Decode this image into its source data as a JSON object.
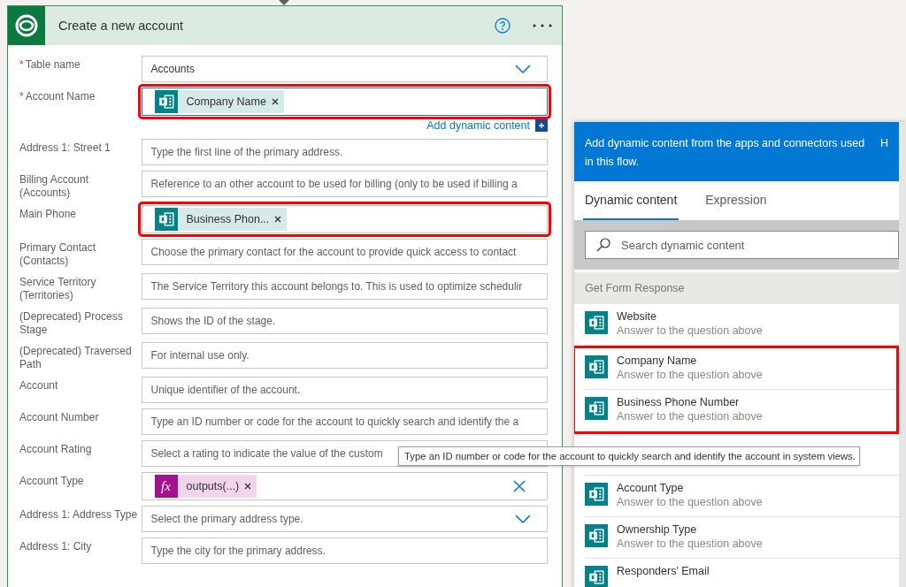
{
  "card": {
    "title": "Create a new account",
    "fields": [
      {
        "label": "Table name",
        "required_mark": "*",
        "kind": "select",
        "value": "Accounts",
        "highlighted": false
      },
      {
        "label": "Account Name",
        "required_mark": "*",
        "kind": "token",
        "token": {
          "text": "Company Name",
          "kind": "forms"
        },
        "highlighted": true,
        "focused": true,
        "link": "Add dynamic content"
      },
      {
        "label": "Address 1: Street 1",
        "kind": "text",
        "placeholder": "Type the first line of the primary address.",
        "highlighted": false
      },
      {
        "label": "Billing Account (Accounts)",
        "kind": "text",
        "placeholder": "Reference to an other account to be used for billing (only to be used if billing a",
        "highlighted": false
      },
      {
        "label": "Main Phone",
        "kind": "token",
        "token": {
          "text": "Business Phon...",
          "kind": "forms"
        },
        "highlighted": true,
        "focused": false
      },
      {
        "label": "Primary Contact (Contacts)",
        "kind": "text",
        "placeholder": "Choose the primary contact for the account to provide quick access to contact",
        "highlighted": false
      },
      {
        "label": "Service Territory (Territories)",
        "kind": "text",
        "placeholder": "The Service Territory this account belongs to. This is used to optimize schedulir",
        "highlighted": false
      },
      {
        "label": "(Deprecated) Process Stage",
        "kind": "text",
        "placeholder": "Shows the ID of the stage.",
        "highlighted": false
      },
      {
        "label": "(Deprecated) Traversed Path",
        "kind": "text",
        "placeholder": "For internal use only.",
        "highlighted": false
      },
      {
        "label": "Account",
        "kind": "text",
        "placeholder": "Unique identifier of the account.",
        "highlighted": false
      },
      {
        "label": "Account Number",
        "kind": "text",
        "placeholder": "Type an ID number or code for the account to quickly search and identify the a",
        "highlighted": false
      },
      {
        "label": "Account Rating",
        "kind": "text",
        "placeholder": "Select a rating to indicate the value of the custom",
        "highlighted": false
      },
      {
        "label": "Account Type",
        "kind": "token",
        "token": {
          "text": "outputs(...)",
          "kind": "expression",
          "icon_label": "fx"
        },
        "clearable": true,
        "highlighted": false,
        "focused": false
      },
      {
        "label": "Address 1: Address Type",
        "kind": "select",
        "placeholder": "Select the primary address type.",
        "highlighted": false
      },
      {
        "label": "Address 1: City",
        "kind": "text",
        "placeholder": "Type the city for the primary address.",
        "highlighted": false
      }
    ]
  },
  "panel": {
    "header": "Add dynamic content from the apps and connectors used in this flow.",
    "header_link": "H",
    "tabs": [
      {
        "label": "Dynamic content",
        "selected": true
      },
      {
        "label": "Expression",
        "selected": false
      }
    ],
    "search": {
      "placeholder": "Search dynamic content"
    },
    "section": "Get Form Response",
    "items": [
      {
        "title": "Website",
        "subtitle": "Answer to the question above",
        "highlighted": false
      },
      {
        "title": "Company Name",
        "subtitle": "Answer to the question above",
        "highlighted": true
      },
      {
        "title": "Business Phone Number",
        "subtitle": "Answer to the question above",
        "highlighted": true
      },
      {
        "highlighted": false
      },
      {
        "title": "Account Type",
        "subtitle": "Answer to the question above",
        "highlighted": false
      },
      {
        "title": "Ownership Type",
        "subtitle": "Answer to the question above",
        "highlighted": false
      },
      {
        "title": "Responders' Email",
        "highlighted": false
      }
    ]
  },
  "tooltip": "Type an ID number or code for the account to quickly search and identify the account in system views."
}
